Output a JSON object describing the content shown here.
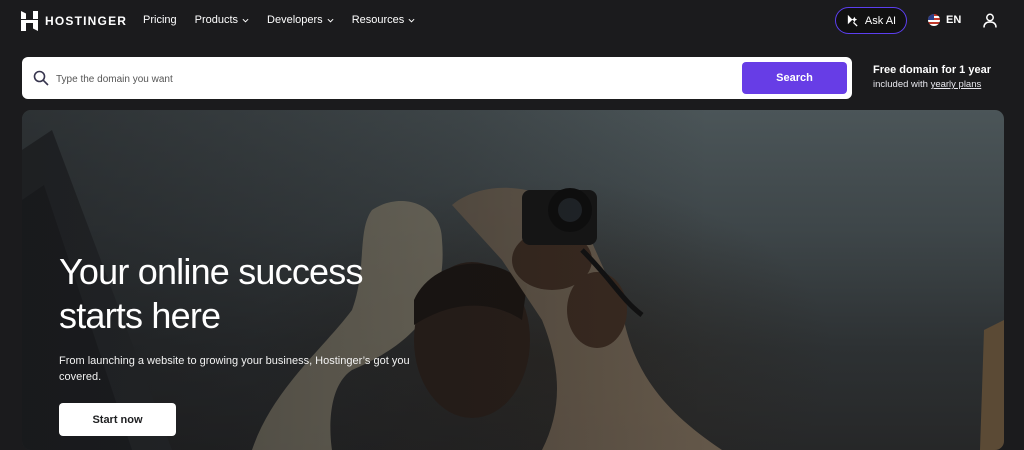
{
  "nav": {
    "brand": "HOSTINGER",
    "links": [
      {
        "label": "Pricing",
        "dropdown": false
      },
      {
        "label": "Products",
        "dropdown": true
      },
      {
        "label": "Developers",
        "dropdown": true
      },
      {
        "label": "Resources",
        "dropdown": true
      }
    ],
    "ask_ai": "Ask AI",
    "language": "EN"
  },
  "search": {
    "placeholder": "Type the domain you want",
    "button": "Search"
  },
  "promo": {
    "title": "Free domain for 1 year",
    "sub_prefix": "included with ",
    "sub_link": "yearly plans"
  },
  "hero": {
    "title_line1": "Your online success",
    "title_line2": "starts here",
    "subtitle": "From launching a website to growing your business, Hostinger’s got you covered.",
    "cta": "Start now"
  },
  "colors": {
    "accent": "#673de6",
    "background": "#1b1b1d"
  }
}
